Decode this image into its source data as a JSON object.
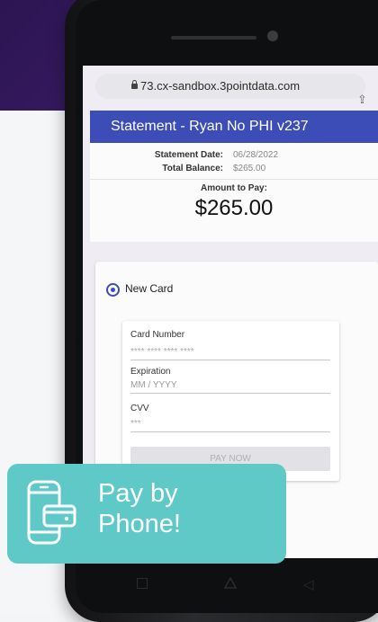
{
  "browser": {
    "url": "73.cx-sandbox.3pointdata.com"
  },
  "statement": {
    "title": "Statement - Ryan No PHI v237",
    "date_label": "Statement Date:",
    "date_value": "06/28/2022",
    "balance_label": "Total Balance:",
    "balance_value": "$265.00",
    "amount_label": "Amount to Pay:",
    "amount_value": "$265.00"
  },
  "payment": {
    "option_label": "New Card",
    "card_number_label": "Card Number",
    "card_number_placeholder": "**** **** **** ****",
    "expiration_label": "Expiration",
    "expiration_placeholder": "MM / YYYY",
    "cvv_label": "CVV",
    "cvv_placeholder": "***",
    "pay_button": "PAY NOW"
  },
  "badge": {
    "line1": "Pay by",
    "line2": "Phone!"
  },
  "colors": {
    "header": "#3c4db8",
    "badge": "#5fc9c8",
    "background_top": "#3b1c66"
  }
}
